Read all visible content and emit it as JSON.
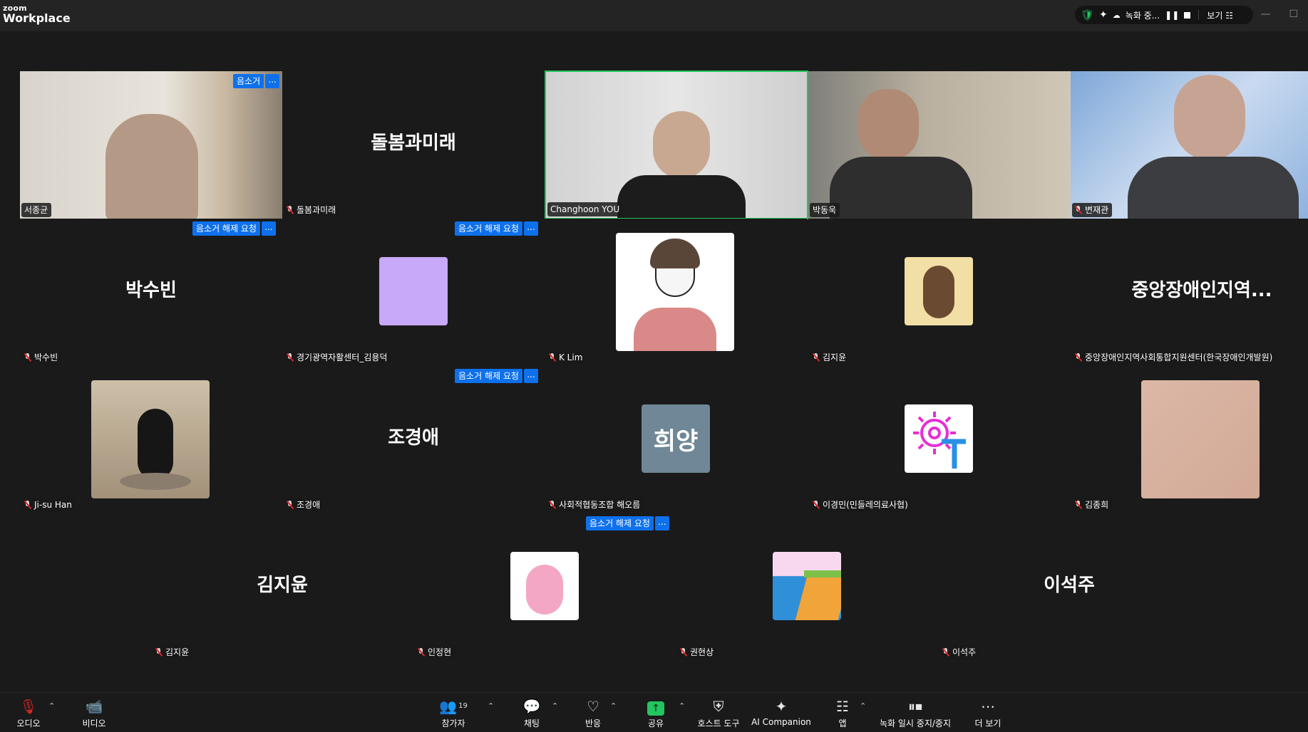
{
  "app": {
    "logo_top": "zoom",
    "logo_bottom": "Workplace"
  },
  "status": {
    "recording": "녹화 중...",
    "view": "보기"
  },
  "tiles": [
    {
      "id": "t1",
      "name": "서종균",
      "muted": false,
      "type": "video"
    },
    {
      "id": "t2",
      "name": "돌봄과미래",
      "display": "돌봄과미래",
      "muted": true,
      "type": "text"
    },
    {
      "id": "t3",
      "name": "Changhoon YOU",
      "muted": false,
      "type": "video",
      "active": true
    },
    {
      "id": "t4",
      "name": "박동욱",
      "muted": false,
      "type": "video"
    },
    {
      "id": "t5",
      "name": "변재관",
      "muted": true,
      "type": "video"
    },
    {
      "id": "t6",
      "name": "박수빈",
      "display": "박수빈",
      "muted": true,
      "type": "text"
    },
    {
      "id": "t7",
      "name": "경기광역자활센터_김용덕",
      "muted": true,
      "type": "avatar",
      "color": "#c8a8f8"
    },
    {
      "id": "t8",
      "name": "K Lim",
      "muted": true,
      "type": "avatar",
      "color": "#ffffff"
    },
    {
      "id": "t9",
      "name": "김지윤",
      "muted": true,
      "type": "avatar",
      "color": "#f2dfa6"
    },
    {
      "id": "t10",
      "name": "중앙장애인지역사회통합지원센터(한국장애인개발원)",
      "display": "중앙장애인지역...",
      "muted": true,
      "type": "text"
    },
    {
      "id": "t11",
      "name": "Ji-su Han",
      "muted": true,
      "type": "avatar",
      "color": "#b7a48c"
    },
    {
      "id": "t12",
      "name": "조경애",
      "display": "조경애",
      "muted": true,
      "type": "text"
    },
    {
      "id": "t13",
      "name": "사회적협동조합 해오름",
      "display": "희양",
      "muted": true,
      "type": "initials",
      "color": "#6f8796"
    },
    {
      "id": "t14",
      "name": "이경민(민들레의료사협)",
      "muted": true,
      "type": "avatar",
      "color": "#ffffff"
    },
    {
      "id": "t15",
      "name": "김종희",
      "muted": true,
      "type": "avatar",
      "color": "#d9b1a1"
    },
    {
      "id": "t16",
      "name": "김지윤",
      "display": "김지윤",
      "muted": true,
      "type": "text"
    },
    {
      "id": "t17",
      "name": "인정현",
      "muted": true,
      "type": "avatar",
      "color": "#ffffff"
    },
    {
      "id": "t18",
      "name": "권현상",
      "muted": true,
      "type": "avatar",
      "color": "#2f8fd8"
    },
    {
      "id": "t19",
      "name": "이석주",
      "display": "이석주",
      "muted": true,
      "type": "text"
    }
  ],
  "requests": {
    "mute_label": "음소거",
    "unmute_label": "음소거 해제 요청",
    "more_label": "..."
  },
  "toolbar": {
    "audio": "오디오",
    "video": "비디오",
    "participants": "참가자",
    "participant_count": "19",
    "chat": "채팅",
    "reactions": "반응",
    "share": "공유",
    "host_tools": "호스트 도구",
    "ai_companion": "AI Companion",
    "apps": "앱",
    "record_pause": "녹화 일시 중지/중지",
    "more": "더 보기"
  },
  "colors": {
    "active_border": "#22c55e",
    "accent_blue": "#0e71eb",
    "muted_red": "#e02424"
  }
}
